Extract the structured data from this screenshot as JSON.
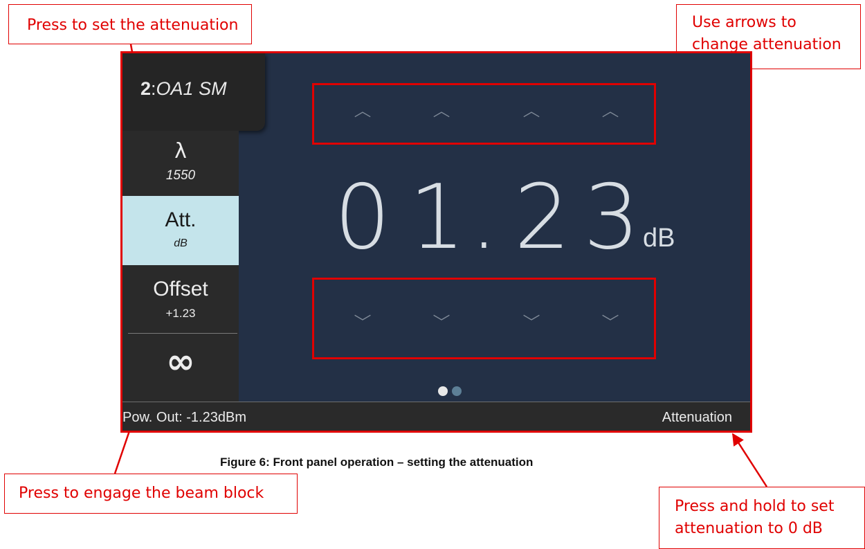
{
  "callouts": {
    "set_attenuation": "Press to set the attenuation",
    "arrows_line1": "Use arrows to",
    "arrows_line2": "change attenuation",
    "beam_block": "Press to engage the beam block",
    "zero_line1": "Press and hold to set",
    "zero_line2": "attenuation to 0 dB"
  },
  "screen": {
    "channel": {
      "number": "2",
      "separator": ":",
      "name": "OA1 SM"
    },
    "sidebar": {
      "wavelength": {
        "label": "λ",
        "value": "1550"
      },
      "attenuation": {
        "label": "Att.",
        "unit": "dB"
      },
      "offset": {
        "label": "Offset",
        "value": "+1.23"
      },
      "beam_block": {
        "label": "∞"
      }
    },
    "up_arrow_glyph": "up-chevron-icon",
    "down_arrow_glyph": "down-chevron-icon",
    "reading": {
      "d1": "0",
      "d2": "1",
      "dot": ".",
      "d3": "2",
      "d4": "3",
      "unit": "dB"
    },
    "status": {
      "left": "Pow. Out: -1.23dBm",
      "right": "Attenuation"
    },
    "page_indicator": {
      "active": 1,
      "total": 2
    }
  },
  "caption": "Figure 6: Front panel operation – setting the attenuation",
  "colors": {
    "annotation_red": "#e00000",
    "screen_bg": "#233046",
    "sidebar_bg": "#2a2a2a",
    "selected_bg": "#c4e4eb"
  }
}
